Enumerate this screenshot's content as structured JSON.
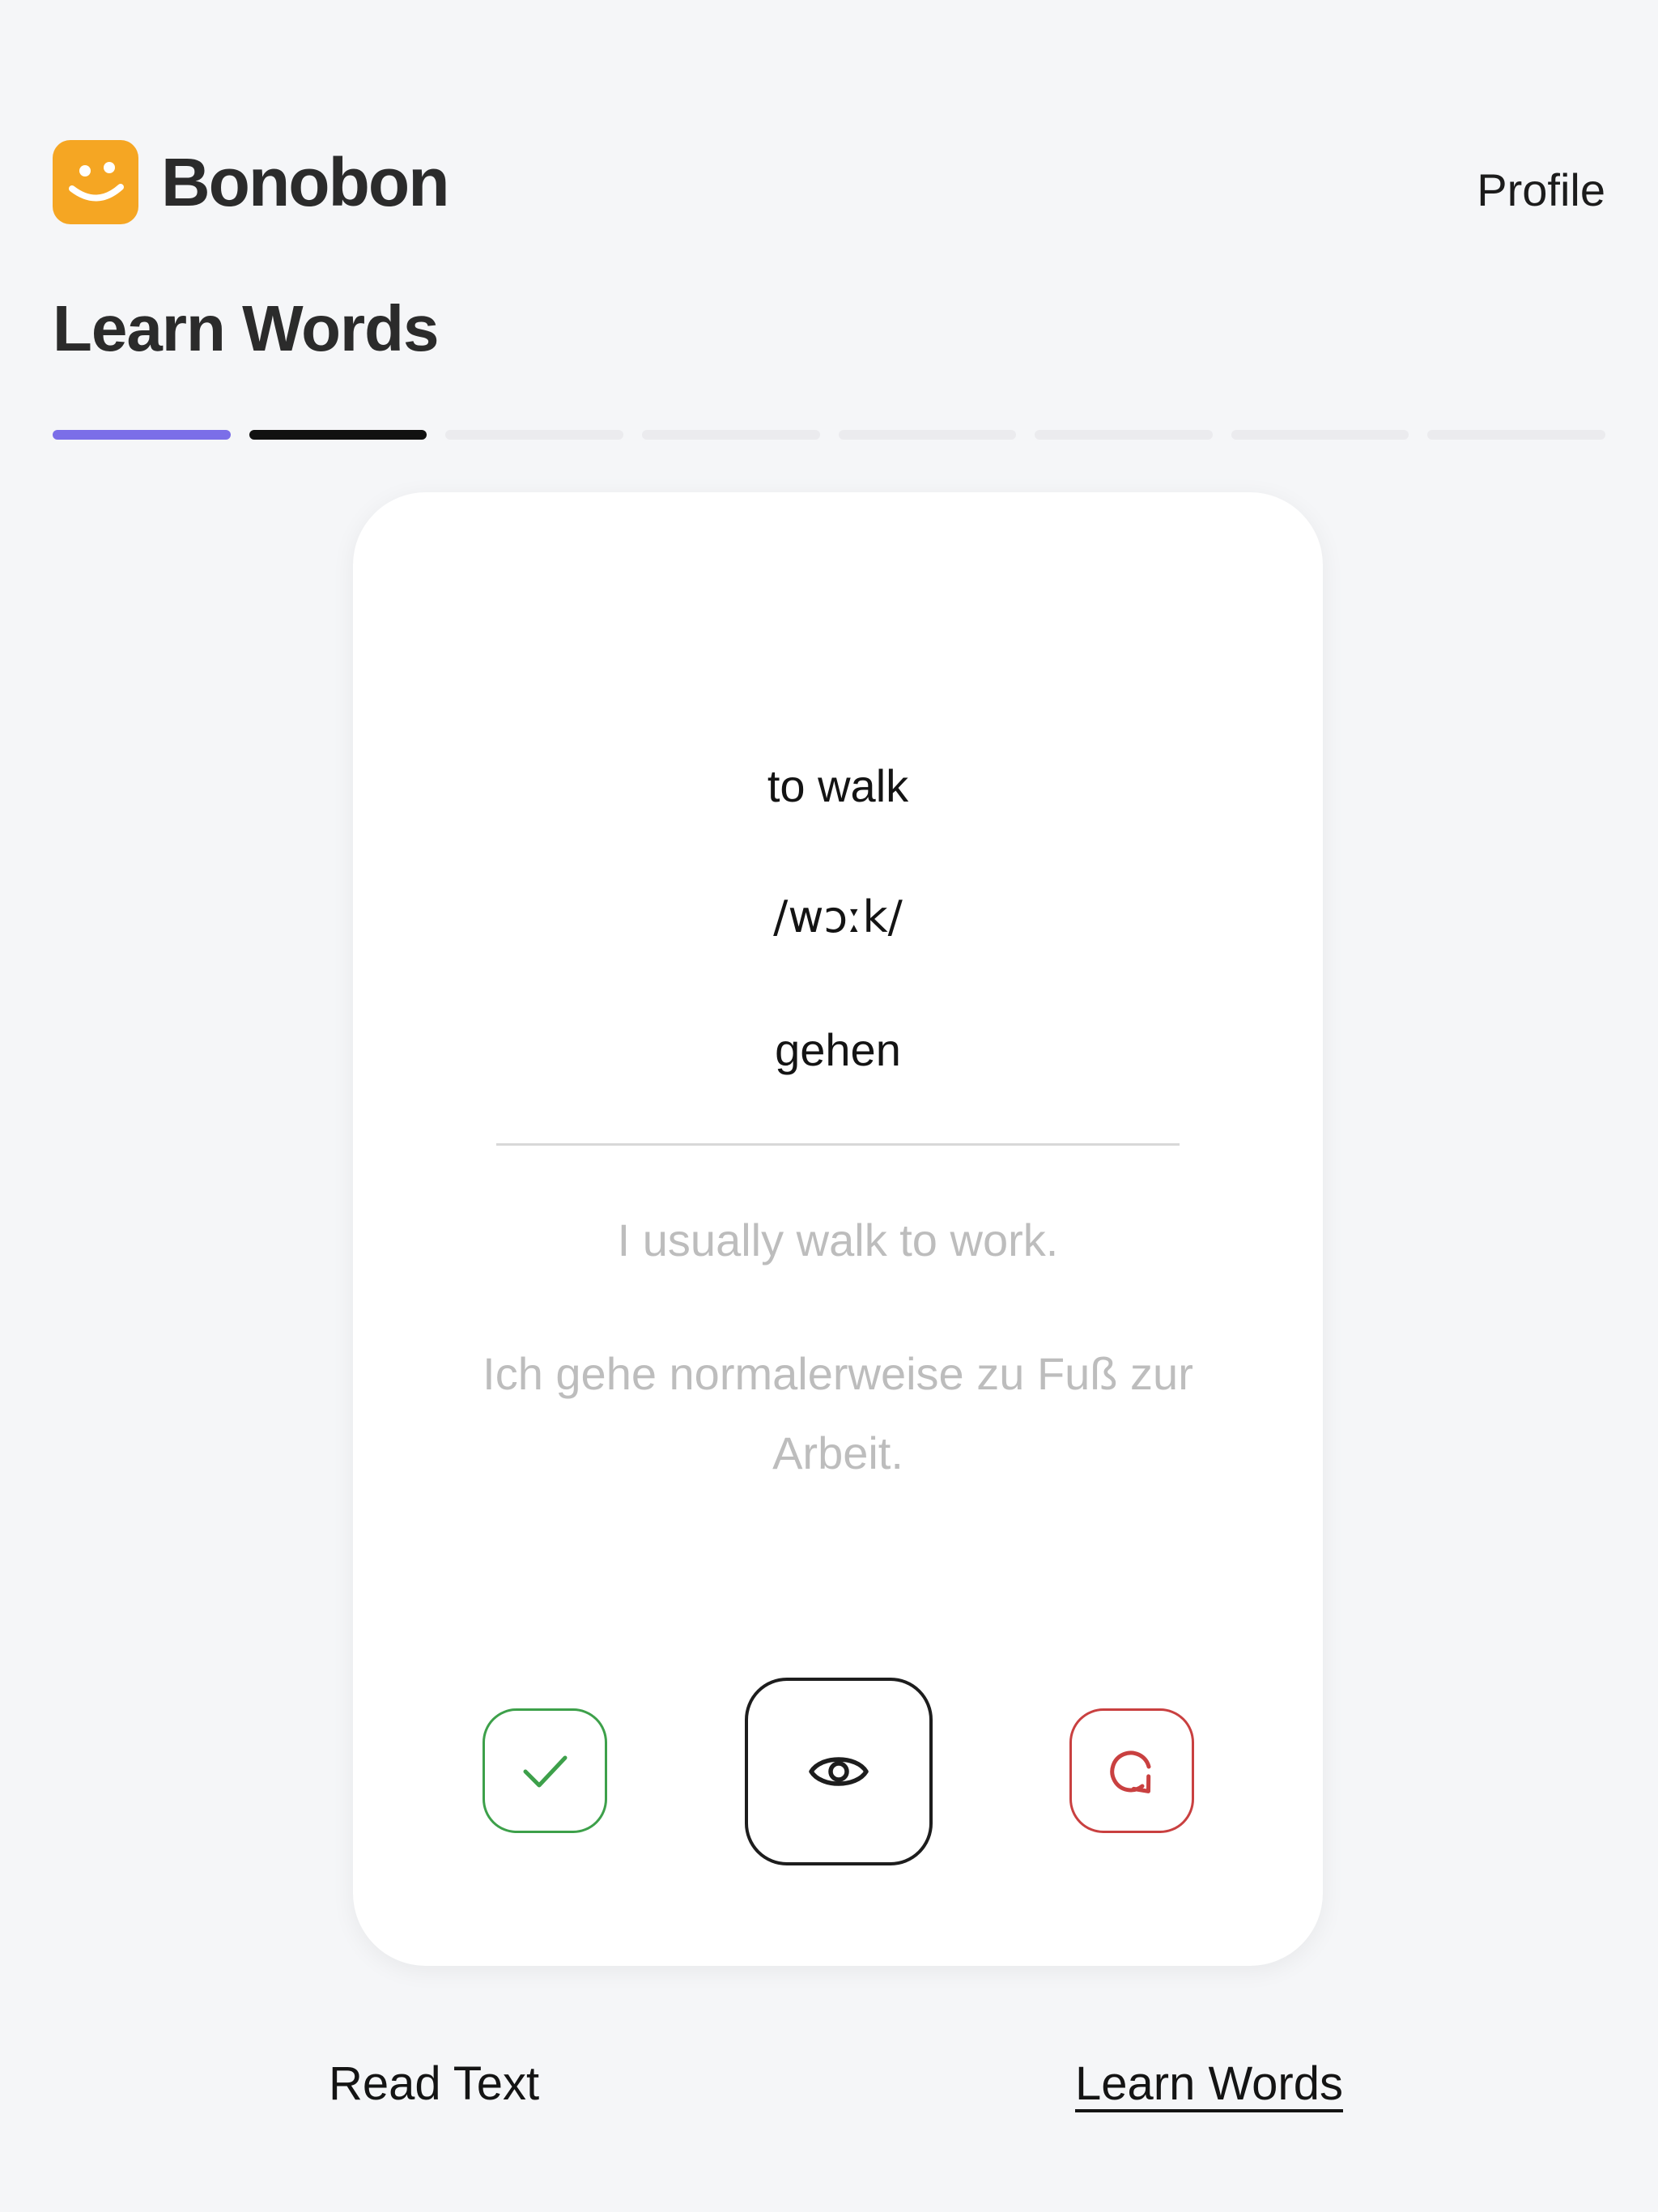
{
  "header": {
    "brand": "Bonobon",
    "logo_icon": "smiley-face-icon",
    "profile_label": "Profile"
  },
  "page": {
    "title": "Learn Words"
  },
  "progress": {
    "total_steps": 8,
    "completed_steps": 1,
    "current_step": 2,
    "colors": {
      "done": "#7b6ee8",
      "current": "#111111",
      "pending": "#ebebee"
    }
  },
  "card": {
    "word": "to walk",
    "ipa": "/wɔːk/",
    "translation": "gehen",
    "example_en": "I usually walk to work.",
    "example_de": "Ich gehe normalerweise zu Fuß zur Arbeit."
  },
  "actions": {
    "known_icon": "check-icon",
    "reveal_icon": "eye-icon",
    "repeat_icon": "repeat-arrow-icon",
    "known_color": "#3da04a",
    "reveal_color": "#1d1d1d",
    "repeat_color": "#c94040"
  },
  "bottom_nav": {
    "items": [
      {
        "label": "Read Text",
        "active": false
      },
      {
        "label": "Learn Words",
        "active": true
      }
    ]
  },
  "colors": {
    "background": "#f5f6f8",
    "brand": "#f5a623"
  }
}
